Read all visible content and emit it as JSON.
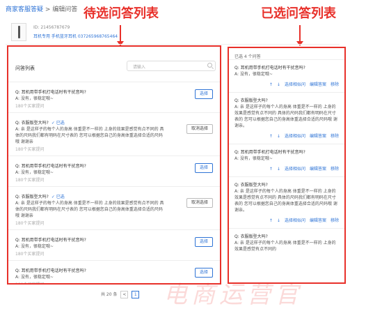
{
  "breadcrumb": {
    "parent": "商家客服答疑",
    "separator": ">",
    "current": "编辑问答"
  },
  "annotations": {
    "left": "待选问答列表",
    "right": "已选问答列表"
  },
  "product": {
    "id_text": "ID: 21456787679",
    "name": "耳机专用 手机蓝牙耳机 037265968765464"
  },
  "left_panel": {
    "title": "问答列表",
    "search_placeholder": "请输入",
    "items": [
      {
        "q": "Q: 耳机用带手机打电话时有干扰音吗?",
        "a": "A: 没有，很稳定哦~",
        "count": "180个买家提问",
        "selected": "",
        "button": "选择"
      },
      {
        "q": "Q: 衣服版型大吗?",
        "a": "A: 亲 是这样子的每个人的身高 体重是不一样的 上身的效果是感觉有点不同的 具体的尺码我们都有明码在尺寸表的 您可以根据您自己的身高体重选择合适的尺码哦 谢谢亲",
        "count": "180个买家提问",
        "selected": "✓ 已选",
        "button": "取消选择"
      },
      {
        "q": "Q: 耳机用带手机打电话时有干扰音吗?",
        "a": "A: 没有，很稳定哦~",
        "count": "180个买家提问",
        "selected": "",
        "button": "选择"
      },
      {
        "q": "Q: 衣服版型大吗?",
        "a": "A: 亲 是这样子的每个人的身高 体重是不一样的 上身的效果是感觉有点不同的 具体的尺码我们都有明码在尺寸表的 您可以根据您自己的身高体重选择合适的尺码哦 谢谢亲",
        "count": "180个买家提问",
        "selected": "✓ 已选",
        "button": "取消选择"
      },
      {
        "q": "Q: 耳机用带手机打电话时有干扰音吗?",
        "a": "A: 没有，很稳定哦~",
        "count": "180个买家提问",
        "selected": "",
        "button": "选择"
      },
      {
        "q": "Q: 耳机用带手机打电话时有干扰音吗?",
        "a": "A: 没有，很稳定哦~",
        "count": "180个买家提问",
        "selected": "",
        "button": "选择"
      }
    ]
  },
  "right_panel": {
    "header": "已选 4 个问答",
    "items": [
      {
        "q": "Q: 耳机用带手机打电话时有干扰音吗?",
        "a": "A: 没有，很稳定哦~",
        "ops": [
          "↑",
          "↓",
          "选择相似问",
          "编辑答案",
          "移除"
        ]
      },
      {
        "q": "Q: 衣服版型大吗?",
        "a": "A: 亲 是这样子的每个人的身高 体重是不一样的 上身的效果是感觉有点不同的 具体的尺码我们都有明码在尺寸表的 您可以根据您自己的身高体重选择合适的尺码哦 谢谢亲。",
        "ops": [
          "↑",
          "↓",
          "选择相似问",
          "编辑答案",
          "移除"
        ]
      },
      {
        "q": "Q: 耳机用带手机打电话时有干扰音吗?",
        "a": "A: 没有，很稳定哦~",
        "ops": [
          "↑",
          "↓",
          "选择相似问",
          "编辑答案",
          "移除"
        ]
      },
      {
        "q": "Q: 衣服版型大吗?",
        "a": "A: 亲 是这样子的每个人的身高 体重是不一样的 上身的效果是感觉有点不同的 具体的尺码我们都有明码在尺寸表的 您可以根据您自己的身高体重选择合适的尺码哦 谢谢亲。",
        "ops": [
          "↑",
          "↓",
          "选择相似问",
          "编辑答案",
          "移除"
        ]
      },
      {
        "q": "Q: 衣服版型大吗?",
        "a": "A: 亲 是这样子的每个人的身高 体重是不一样的 上身的效果是感觉有点不同的",
        "ops": []
      }
    ]
  },
  "pagination": {
    "total": "共 20 条",
    "prev": "<",
    "current": "1"
  },
  "watermark": "电商运营官"
}
